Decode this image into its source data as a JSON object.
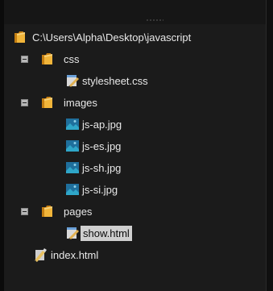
{
  "tree": {
    "root": {
      "label": "C:\\Users\\Alpha\\Desktop\\javascript",
      "icon": "folder-icon"
    },
    "css": {
      "label": "css",
      "icon": "folder-icon",
      "files": [
        {
          "label": "stylesheet.css",
          "icon": "css-file-icon"
        }
      ]
    },
    "images": {
      "label": "images",
      "icon": "folder-icon",
      "files": [
        {
          "label": "js-ap.jpg",
          "icon": "image-file-icon"
        },
        {
          "label": "js-es.jpg",
          "icon": "image-file-icon"
        },
        {
          "label": "js-sh.jpg",
          "icon": "image-file-icon"
        },
        {
          "label": "js-si.jpg",
          "icon": "image-file-icon"
        }
      ]
    },
    "pages": {
      "label": "pages",
      "icon": "folder-icon",
      "files": [
        {
          "label": "show.html",
          "icon": "html-file-icon",
          "selected": true
        }
      ]
    },
    "index": {
      "label": "index.html",
      "icon": "html-file-icon"
    }
  },
  "colors": {
    "background": "#1b1b1b",
    "folder": "#e8a42c",
    "selection": "#cfcfcf"
  }
}
